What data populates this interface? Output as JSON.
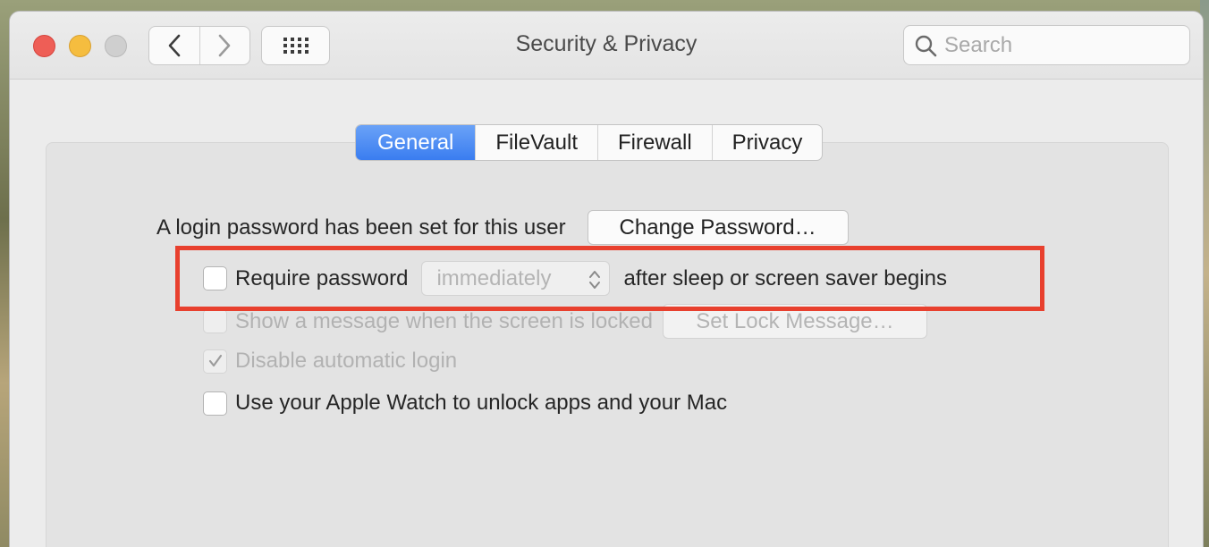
{
  "window": {
    "title": "Security & Privacy"
  },
  "search": {
    "placeholder": "Search"
  },
  "tabs": [
    {
      "label": "General",
      "active": true
    },
    {
      "label": "FileVault",
      "active": false
    },
    {
      "label": "Firewall",
      "active": false
    },
    {
      "label": "Privacy",
      "active": false
    }
  ],
  "general": {
    "login_text": "A login password has been set for this user",
    "change_password_label": "Change Password…",
    "require_password": {
      "label": "Require password",
      "checked": false,
      "popup_value": "immediately",
      "suffix": "after sleep or screen saver begins"
    },
    "show_message": {
      "label": "Show a message when the screen is locked",
      "checked": false,
      "enabled": false,
      "button_label": "Set Lock Message…"
    },
    "disable_auto_login": {
      "label": "Disable automatic login",
      "checked": true,
      "enabled": false
    },
    "apple_watch": {
      "label": "Use your Apple Watch to unlock apps and your Mac",
      "checked": false
    }
  },
  "colors": {
    "accent": "#3a7df0",
    "highlight": "#e8402e"
  },
  "icons": {
    "back": "chevron-left-icon",
    "forward": "chevron-right-icon",
    "show_all": "grid-icon",
    "search": "magnifier-icon",
    "popup": "up-down-arrows-icon",
    "check": "checkmark-icon"
  }
}
